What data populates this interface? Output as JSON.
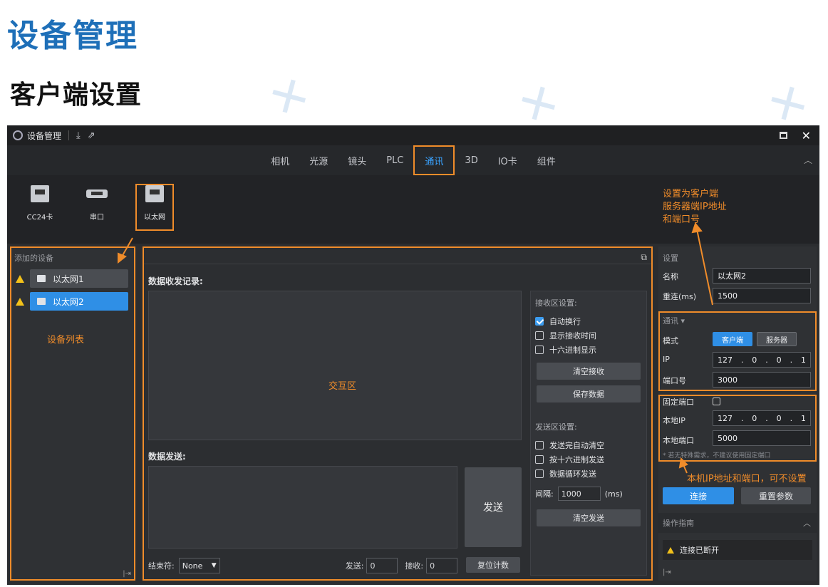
{
  "slide": {
    "title": "设备管理",
    "subtitle": "客户端设置"
  },
  "window": {
    "title": "设备管理",
    "tabs": [
      "相机",
      "光源",
      "镜头",
      "PLC",
      "通讯",
      "3D",
      "IO卡",
      "组件"
    ],
    "active_tab": "通讯",
    "device_types": [
      "CC24卡",
      "串口",
      "以太网"
    ]
  },
  "left_panel": {
    "header": "添加的设备",
    "devices": [
      "以太网1",
      "以太网2"
    ],
    "annotation": "设备列表"
  },
  "middle_panel": {
    "rx_label": "数据收发记录:",
    "rx_annotation": "交互区",
    "tx_label": "数据发送:",
    "send_button": "发送",
    "terminator_label": "结束符:",
    "terminator_value": "None",
    "send_count_label": "发送:",
    "send_count": "0",
    "recv_count_label": "接收:",
    "recv_count": "0",
    "reset_count_button": "复位计数",
    "rx_settings": {
      "header": "接收区设置:",
      "options": [
        "自动换行",
        "显示接收时间",
        "十六进制显示"
      ],
      "checked": [
        true,
        false,
        false
      ],
      "clear_button": "清空接收",
      "save_button": "保存数据"
    },
    "tx_settings": {
      "header": "发送区设置:",
      "options": [
        "发送完自动清空",
        "按十六进制发送",
        "数据循环发送"
      ],
      "interval_label": "间隔:",
      "interval_value": "1000",
      "interval_unit": "(ms)",
      "clear_button": "清空发送"
    }
  },
  "right_panel": {
    "settings_header": "设置",
    "name_label": "名称",
    "name_value": "以太网2",
    "reconnect_label": "重连(ms)",
    "reconnect_value": "1500",
    "comm_header": "通讯 ▾",
    "mode_label": "模式",
    "mode_client": "客户端",
    "mode_server": "服务器",
    "ip_label": "IP",
    "ip": [
      "127",
      "0",
      "0",
      "1"
    ],
    "port_label": "端口号",
    "port_value": "3000",
    "fixed_port_label": "固定端口",
    "local_ip_label": "本地IP",
    "local_ip": [
      "127",
      "0",
      "0",
      "1"
    ],
    "local_port_label": "本地端口",
    "local_port_value": "5000",
    "hint": "* 若无特殊需求，不建议使用固定端口",
    "connect_button": "连接",
    "reset_params_button": "重置参数",
    "guide_header": "操作指南",
    "status": "连接已断开"
  },
  "annotations": {
    "client_setup": [
      "设置为客户端",
      "服务器端IP地址",
      "和端口号"
    ],
    "local": "本机IP地址和端口，可不设置"
  }
}
